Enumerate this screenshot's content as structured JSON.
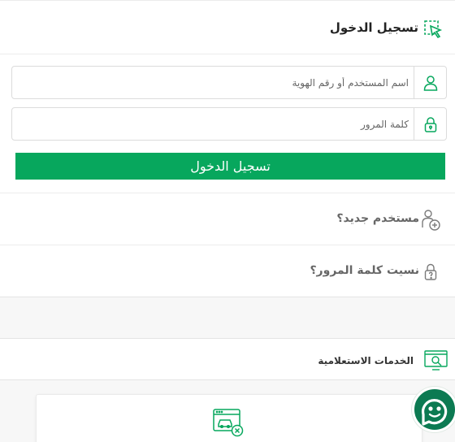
{
  "login": {
    "title": "تسجيل الدخول",
    "username_placeholder": "اسم المستخدم أو رقم الهوية",
    "password_placeholder": "كلمة المرور",
    "submit_label": "تسجيل الدخول"
  },
  "links": {
    "new_user": "مستخدم جديد؟",
    "forgot_password": "نسيت كلمة المرور؟"
  },
  "inquiry": {
    "title": "الخدمات الاستعلامية"
  },
  "icons": {
    "login": "cursor-click-icon",
    "user": "user-icon",
    "lock": "lock-icon",
    "new_user": "add-user-icon",
    "forgot": "lock-question-icon",
    "inquiry": "screen-search-icon",
    "card": "vehicle-screen-cancel-icon",
    "chat": "chat-bot-icon"
  },
  "colors": {
    "accent": "#07a75d",
    "chat": "#0c7a52"
  }
}
